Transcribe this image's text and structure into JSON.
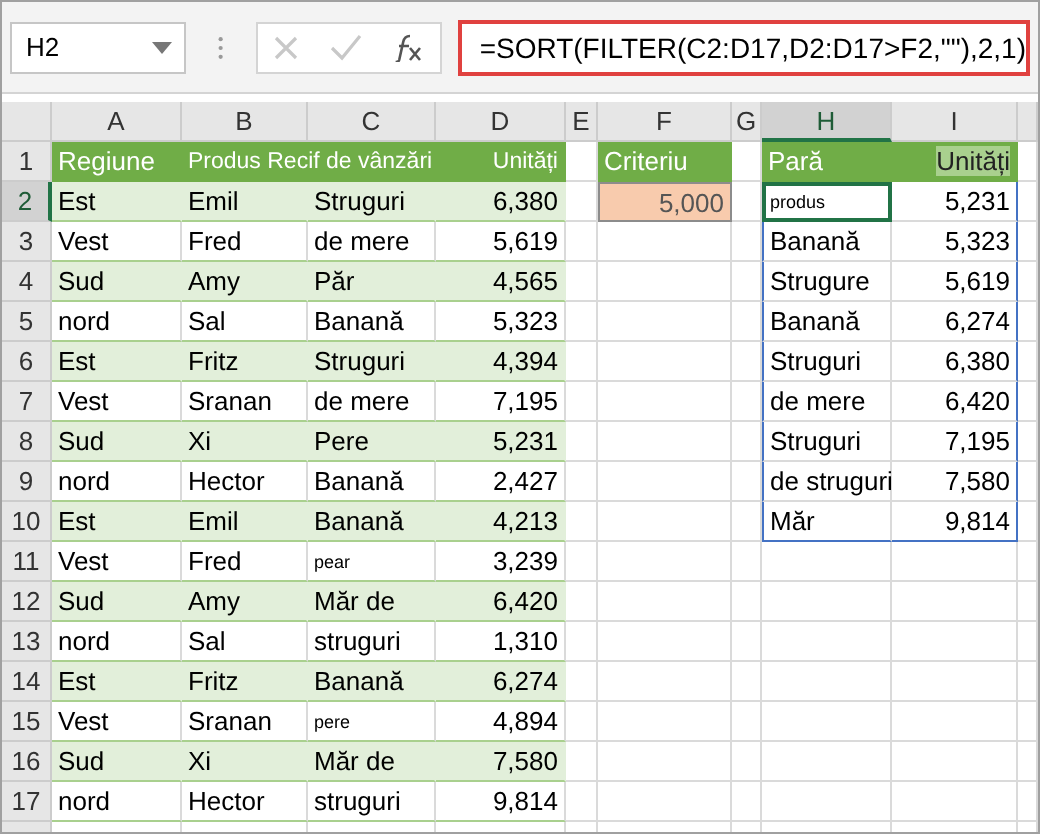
{
  "name_box": "H2",
  "formula": "=SORT(FILTER(C2:D17,D2:D17>F2,\"\"),2,1)",
  "columns": [
    {
      "label": "A",
      "selected": false
    },
    {
      "label": "B",
      "selected": false
    },
    {
      "label": "C",
      "selected": false
    },
    {
      "label": "D",
      "selected": false
    },
    {
      "label": "E",
      "selected": false
    },
    {
      "label": "F",
      "selected": false
    },
    {
      "label": "G",
      "selected": false
    },
    {
      "label": "H",
      "selected": true
    },
    {
      "label": "I",
      "selected": false
    }
  ],
  "row_numbers": [
    {
      "label": "1",
      "selected": false
    },
    {
      "label": "2",
      "selected": true
    },
    {
      "label": "3",
      "selected": false
    },
    {
      "label": "4",
      "selected": false
    },
    {
      "label": "5",
      "selected": false
    },
    {
      "label": "6",
      "selected": false
    },
    {
      "label": "7",
      "selected": false
    },
    {
      "label": "8",
      "selected": false
    },
    {
      "label": "9",
      "selected": false
    },
    {
      "label": "10",
      "selected": false
    },
    {
      "label": "11",
      "selected": false
    },
    {
      "label": "12",
      "selected": false
    },
    {
      "label": "13",
      "selected": false
    },
    {
      "label": "14",
      "selected": false
    },
    {
      "label": "15",
      "selected": false
    },
    {
      "label": "16",
      "selected": false
    },
    {
      "label": "17",
      "selected": false
    }
  ],
  "source_table": {
    "headers": [
      "Regiune",
      "Produs Recif de vânzări",
      "Unități"
    ],
    "rows": [
      {
        "region": "Est",
        "name": "Emil",
        "product": "Struguri",
        "units": "6,380",
        "banded": true,
        "small": false
      },
      {
        "region": "Vest",
        "name": "Fred",
        "product": "de mere",
        "units": "5,619",
        "banded": false,
        "small": false
      },
      {
        "region": "Sud",
        "name": "Amy",
        "product": "Păr",
        "units": "4,565",
        "banded": true,
        "small": false
      },
      {
        "region": "nord",
        "name": "Sal",
        "product": "Banană",
        "units": "5,323",
        "banded": false,
        "small": false
      },
      {
        "region": "Est",
        "name": "Fritz",
        "product": "Struguri",
        "units": "4,394",
        "banded": true,
        "small": false
      },
      {
        "region": "Vest",
        "name": "Sranan",
        "product": "de mere",
        "units": "7,195",
        "banded": false,
        "small": false
      },
      {
        "region": "Sud",
        "name": "Xi",
        "product": "Pere",
        "units": "5,231",
        "banded": true,
        "small": false
      },
      {
        "region": "nord",
        "name": "Hector",
        "product": "Banană",
        "units": "2,427",
        "banded": false,
        "small": false
      },
      {
        "region": "Est",
        "name": "Emil",
        "product": "Banană",
        "units": "4,213",
        "banded": true,
        "small": false
      },
      {
        "region": "Vest",
        "name": "Fred",
        "product": "pear",
        "units": "3,239",
        "banded": false,
        "small": true
      },
      {
        "region": "Sud",
        "name": "Amy",
        "product": "Măr de",
        "units": "6,420",
        "banded": true,
        "small": false
      },
      {
        "region": "nord",
        "name": "Sal",
        "product": "struguri",
        "units": "1,310",
        "banded": false,
        "small": false
      },
      {
        "region": "Est",
        "name": "Fritz",
        "product": "Banană",
        "units": "6,274",
        "banded": true,
        "small": false
      },
      {
        "region": "Vest",
        "name": "Sranan",
        "product": "pere",
        "units": "4,894",
        "banded": false,
        "small": true
      },
      {
        "region": "Sud",
        "name": "Xi",
        "product": "Măr de",
        "units": "7,580",
        "banded": true,
        "small": false
      },
      {
        "region": "nord",
        "name": "Hector",
        "product": "struguri",
        "units": "9,814",
        "banded": false,
        "small": false
      }
    ]
  },
  "criteria": {
    "header": "Criteriu",
    "value": "5,000"
  },
  "results": {
    "headers": [
      "Pară",
      "Unități"
    ],
    "rows": [
      {
        "product": "produs",
        "units": "5,231",
        "selected": true,
        "small": true
      },
      {
        "product": "Banană",
        "units": "5,323",
        "selected": false,
        "small": false
      },
      {
        "product": "Strugure",
        "units": "5,619",
        "selected": false,
        "small": false
      },
      {
        "product": "Banană",
        "units": "6,274",
        "selected": false,
        "small": false
      },
      {
        "product": "Struguri",
        "units": "6,380",
        "selected": false,
        "small": false
      },
      {
        "product": "de mere",
        "units": "6,420",
        "selected": false,
        "small": false
      },
      {
        "product": "Struguri",
        "units": "7,195",
        "selected": false,
        "small": false
      },
      {
        "product": "de struguri",
        "units": "7,580",
        "selected": false,
        "small": false
      },
      {
        "product": "Măr",
        "units": "9,814",
        "selected": false,
        "small": false
      }
    ]
  }
}
